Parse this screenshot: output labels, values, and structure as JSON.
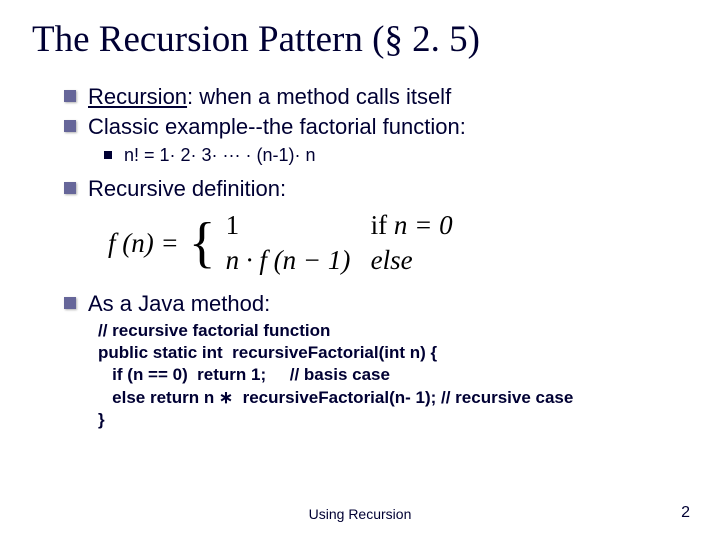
{
  "title": "The Recursion Pattern (§ 2. 5)",
  "bullets": {
    "b1_label": "Recursion",
    "b1_rest": ": when a method calls itself",
    "b2": "Classic example--the factorial function:",
    "b2_sub": "n! = 1· 2· 3· ··· · (n-1)· n",
    "b3": "Recursive definition:",
    "b4": "As a Java method:"
  },
  "formula": {
    "lhs": "f (n) =",
    "case1_val": "1",
    "case1_cond_if": "if",
    "case1_cond_expr": "n = 0",
    "case2_val": "n · f (n − 1)",
    "case2_cond": "else"
  },
  "code": {
    "l1": "// recursive factorial function",
    "l2": "public static int  recursiveFactorial(int n) {",
    "l3": "   if (n == 0)  return 1;     // basis case",
    "l4": "   else return n ∗  recursiveFactorial(n- 1); // recursive case",
    "l5": "}"
  },
  "footer": {
    "center": "Using Recursion",
    "page": "2"
  }
}
